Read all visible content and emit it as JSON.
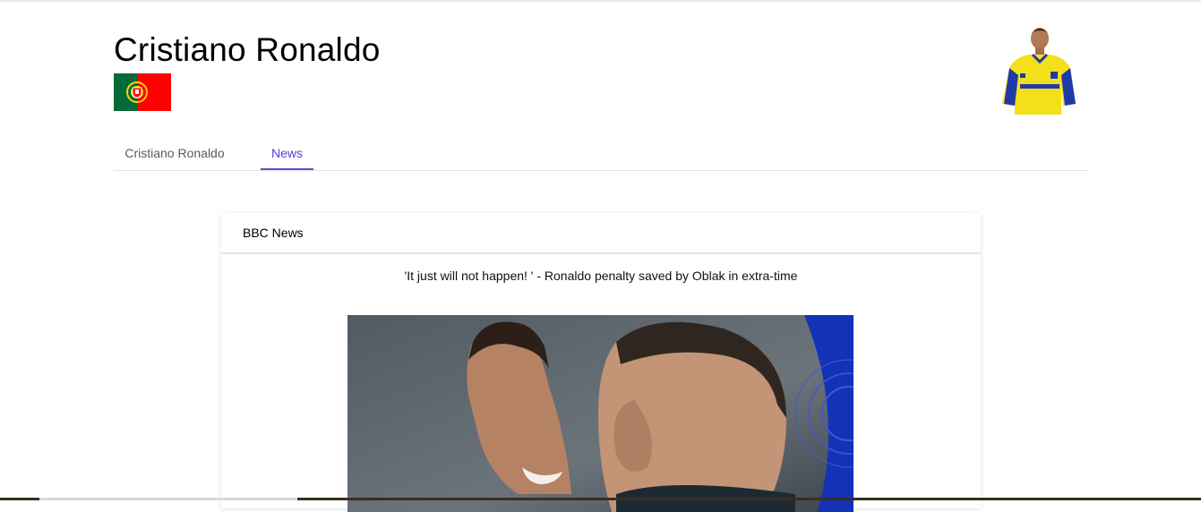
{
  "header": {
    "player_name": "Cristiano Ronaldo",
    "flag_icon": "portugal-flag-icon",
    "flag_colors": {
      "green": "#046a38",
      "red": "#ff0000",
      "yellow": "#ffd700"
    },
    "photo_icon": "player-photo"
  },
  "tabs": [
    {
      "label": "Cristiano Ronaldo",
      "active": false
    },
    {
      "label": "News",
      "active": true
    }
  ],
  "accent_color": "#5b4fd6",
  "news": {
    "source": "BBC News",
    "article_title": "'It just will not happen! ' - Ronaldo penalty saved by Oblak in extra-time",
    "image_icon": "article-photo"
  }
}
